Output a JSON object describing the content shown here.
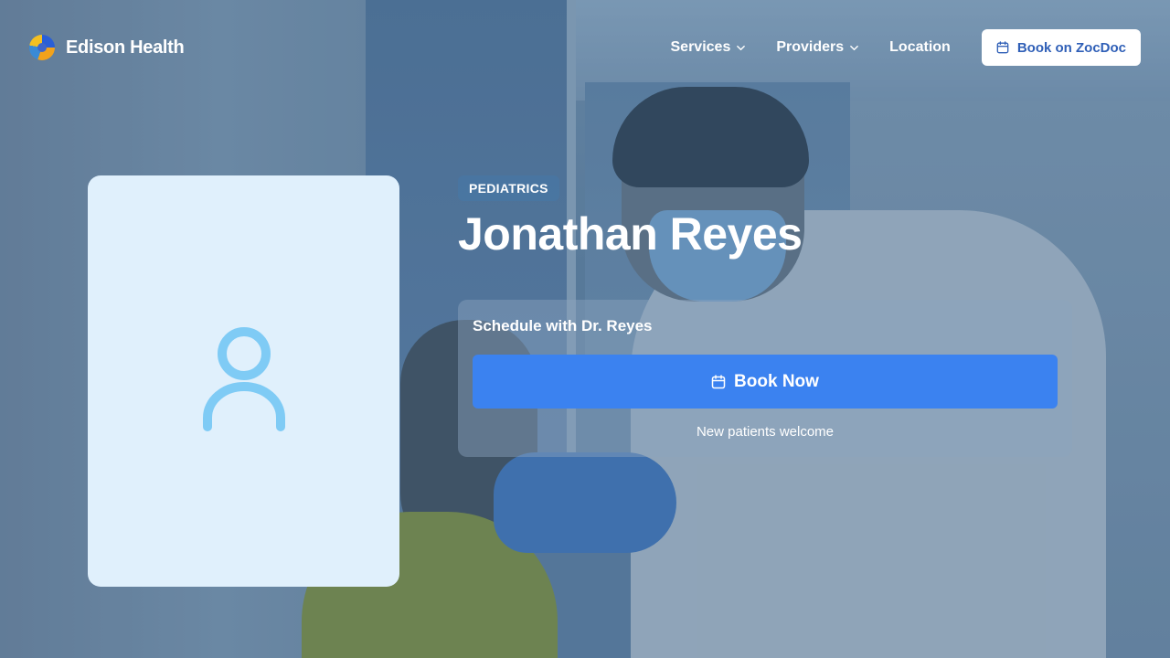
{
  "brand": {
    "name": "Edison Health"
  },
  "nav": {
    "items": [
      {
        "label": "Services",
        "has_dropdown": true
      },
      {
        "label": "Providers",
        "has_dropdown": true
      },
      {
        "label": "Location",
        "has_dropdown": false
      }
    ],
    "cta_label": "Book on ZocDoc",
    "cta_icon": "calendar-icon"
  },
  "provider": {
    "specialty": "PEDIATRICS",
    "name": "Jonathan Reyes",
    "photo_icon": "person-placeholder-icon"
  },
  "schedule": {
    "title": "Schedule with Dr. Reyes",
    "button_label": "Book Now",
    "button_icon": "calendar-icon",
    "note": "New patients welcome"
  },
  "colors": {
    "accent": "#3b82f0",
    "card_bg": "#e0f0fc",
    "icon_color": "#7fcbf5"
  }
}
